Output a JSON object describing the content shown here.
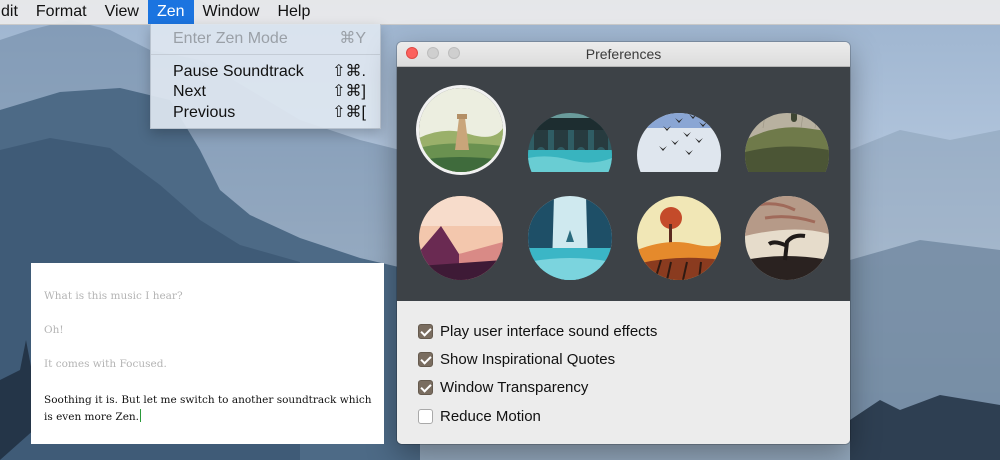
{
  "menubar": {
    "items": [
      {
        "label": "dit"
      },
      {
        "label": "Format"
      },
      {
        "label": "View"
      },
      {
        "label": "Zen"
      },
      {
        "label": "Window"
      },
      {
        "label": "Help"
      }
    ]
  },
  "zen_menu": {
    "items": [
      {
        "label": "Enter Zen Mode",
        "shortcut": "⌘Y",
        "enabled": false
      },
      {
        "label": "Pause Soundtrack",
        "shortcut": "⇧⌘.",
        "enabled": true
      },
      {
        "label": "Next",
        "shortcut": "⇧⌘]",
        "enabled": true
      },
      {
        "label": "Previous",
        "shortcut": "⇧⌘[",
        "enabled": true
      }
    ]
  },
  "preferences": {
    "title": "Preferences",
    "themes": [
      {
        "icon": "tower-hills-theme-icon",
        "selected": true
      },
      {
        "icon": "aqueduct-theme-icon",
        "selected": false
      },
      {
        "icon": "birds-theme-icon",
        "selected": false
      },
      {
        "icon": "hill-monolith-theme-icon",
        "selected": false
      },
      {
        "icon": "pink-mountain-theme-icon",
        "selected": false
      },
      {
        "icon": "canyon-lagoon-theme-icon",
        "selected": false
      },
      {
        "icon": "autumn-tree-theme-icon",
        "selected": false
      },
      {
        "icon": "windy-tree-theme-icon",
        "selected": false
      }
    ],
    "options": [
      {
        "label": "Play user interface sound effects",
        "checked": true
      },
      {
        "label": "Show Inspirational Quotes",
        "checked": true
      },
      {
        "label": "Window Transparency",
        "checked": true
      },
      {
        "label": "Reduce Motion",
        "checked": false
      }
    ]
  },
  "editor": {
    "lines": [
      "What is this music I hear?",
      "Oh!",
      "It comes with Focused.",
      "Soothing it is. But let me switch to another soundtrack which is even more Zen."
    ]
  },
  "colors": {
    "menu_highlight": "#1b74e0",
    "checkbox_fill": "#7a6d60",
    "theme_panel": "#3d4247",
    "close_button": "#fc615d",
    "cursor": "#2a9a3a"
  }
}
